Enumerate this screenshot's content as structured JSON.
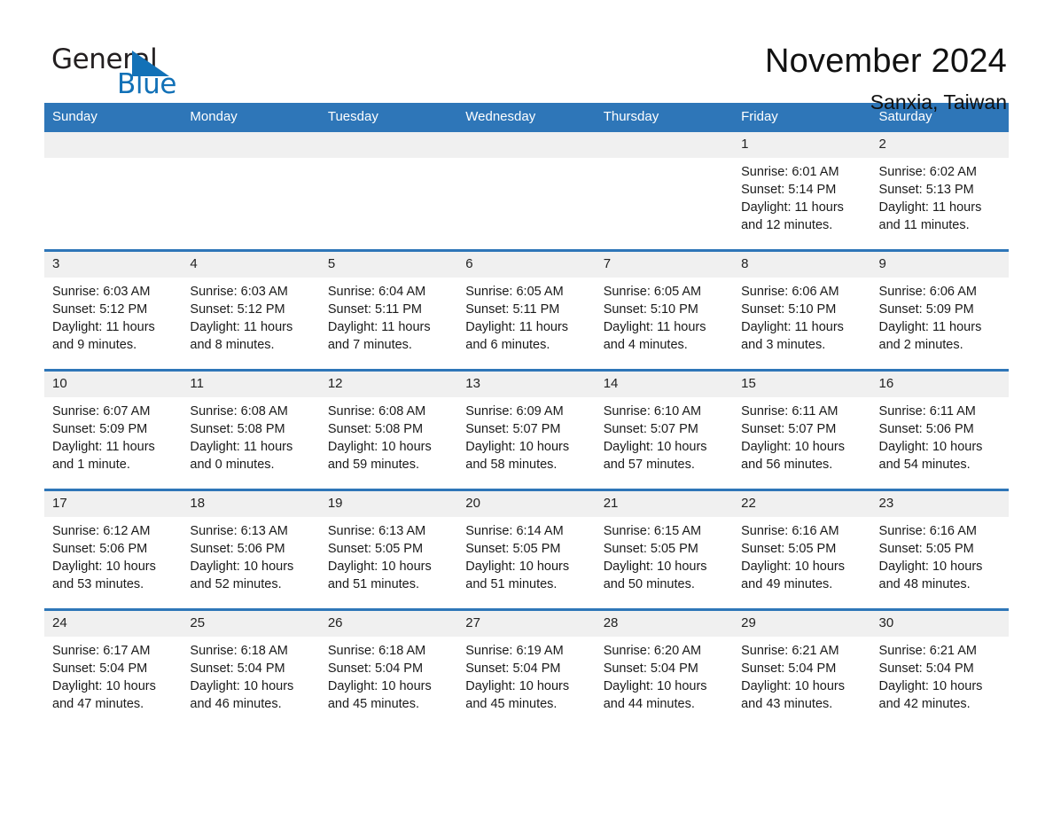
{
  "logo": {
    "word1": "General",
    "word2": "Blue",
    "triangle_color": "#1271b7",
    "icon": "triangle-icon"
  },
  "header": {
    "title": "November 2024",
    "subtitle": "Sanxia, Taiwan"
  },
  "colors": {
    "header_blue": "#2e76b8",
    "daynum_gray": "#f0f0f0",
    "text": "#1a1a1a"
  },
  "calendar": {
    "weekday_headers": [
      "Sunday",
      "Monday",
      "Tuesday",
      "Wednesday",
      "Thursday",
      "Friday",
      "Saturday"
    ],
    "weeks": [
      [
        {
          "day": "",
          "empty": true
        },
        {
          "day": "",
          "empty": true
        },
        {
          "day": "",
          "empty": true
        },
        {
          "day": "",
          "empty": true
        },
        {
          "day": "",
          "empty": true
        },
        {
          "day": "1",
          "sunrise": "Sunrise: 6:01 AM",
          "sunset": "Sunset: 5:14 PM",
          "daylight1": "Daylight: 11 hours",
          "daylight2": "and 12 minutes."
        },
        {
          "day": "2",
          "sunrise": "Sunrise: 6:02 AM",
          "sunset": "Sunset: 5:13 PM",
          "daylight1": "Daylight: 11 hours",
          "daylight2": "and 11 minutes."
        }
      ],
      [
        {
          "day": "3",
          "sunrise": "Sunrise: 6:03 AM",
          "sunset": "Sunset: 5:12 PM",
          "daylight1": "Daylight: 11 hours",
          "daylight2": "and 9 minutes."
        },
        {
          "day": "4",
          "sunrise": "Sunrise: 6:03 AM",
          "sunset": "Sunset: 5:12 PM",
          "daylight1": "Daylight: 11 hours",
          "daylight2": "and 8 minutes."
        },
        {
          "day": "5",
          "sunrise": "Sunrise: 6:04 AM",
          "sunset": "Sunset: 5:11 PM",
          "daylight1": "Daylight: 11 hours",
          "daylight2": "and 7 minutes."
        },
        {
          "day": "6",
          "sunrise": "Sunrise: 6:05 AM",
          "sunset": "Sunset: 5:11 PM",
          "daylight1": "Daylight: 11 hours",
          "daylight2": "and 6 minutes."
        },
        {
          "day": "7",
          "sunrise": "Sunrise: 6:05 AM",
          "sunset": "Sunset: 5:10 PM",
          "daylight1": "Daylight: 11 hours",
          "daylight2": "and 4 minutes."
        },
        {
          "day": "8",
          "sunrise": "Sunrise: 6:06 AM",
          "sunset": "Sunset: 5:10 PM",
          "daylight1": "Daylight: 11 hours",
          "daylight2": "and 3 minutes."
        },
        {
          "day": "9",
          "sunrise": "Sunrise: 6:06 AM",
          "sunset": "Sunset: 5:09 PM",
          "daylight1": "Daylight: 11 hours",
          "daylight2": "and 2 minutes."
        }
      ],
      [
        {
          "day": "10",
          "sunrise": "Sunrise: 6:07 AM",
          "sunset": "Sunset: 5:09 PM",
          "daylight1": "Daylight: 11 hours",
          "daylight2": "and 1 minute."
        },
        {
          "day": "11",
          "sunrise": "Sunrise: 6:08 AM",
          "sunset": "Sunset: 5:08 PM",
          "daylight1": "Daylight: 11 hours",
          "daylight2": "and 0 minutes."
        },
        {
          "day": "12",
          "sunrise": "Sunrise: 6:08 AM",
          "sunset": "Sunset: 5:08 PM",
          "daylight1": "Daylight: 10 hours",
          "daylight2": "and 59 minutes."
        },
        {
          "day": "13",
          "sunrise": "Sunrise: 6:09 AM",
          "sunset": "Sunset: 5:07 PM",
          "daylight1": "Daylight: 10 hours",
          "daylight2": "and 58 minutes."
        },
        {
          "day": "14",
          "sunrise": "Sunrise: 6:10 AM",
          "sunset": "Sunset: 5:07 PM",
          "daylight1": "Daylight: 10 hours",
          "daylight2": "and 57 minutes."
        },
        {
          "day": "15",
          "sunrise": "Sunrise: 6:11 AM",
          "sunset": "Sunset: 5:07 PM",
          "daylight1": "Daylight: 10 hours",
          "daylight2": "and 56 minutes."
        },
        {
          "day": "16",
          "sunrise": "Sunrise: 6:11 AM",
          "sunset": "Sunset: 5:06 PM",
          "daylight1": "Daylight: 10 hours",
          "daylight2": "and 54 minutes."
        }
      ],
      [
        {
          "day": "17",
          "sunrise": "Sunrise: 6:12 AM",
          "sunset": "Sunset: 5:06 PM",
          "daylight1": "Daylight: 10 hours",
          "daylight2": "and 53 minutes."
        },
        {
          "day": "18",
          "sunrise": "Sunrise: 6:13 AM",
          "sunset": "Sunset: 5:06 PM",
          "daylight1": "Daylight: 10 hours",
          "daylight2": "and 52 minutes."
        },
        {
          "day": "19",
          "sunrise": "Sunrise: 6:13 AM",
          "sunset": "Sunset: 5:05 PM",
          "daylight1": "Daylight: 10 hours",
          "daylight2": "and 51 minutes."
        },
        {
          "day": "20",
          "sunrise": "Sunrise: 6:14 AM",
          "sunset": "Sunset: 5:05 PM",
          "daylight1": "Daylight: 10 hours",
          "daylight2": "and 51 minutes."
        },
        {
          "day": "21",
          "sunrise": "Sunrise: 6:15 AM",
          "sunset": "Sunset: 5:05 PM",
          "daylight1": "Daylight: 10 hours",
          "daylight2": "and 50 minutes."
        },
        {
          "day": "22",
          "sunrise": "Sunrise: 6:16 AM",
          "sunset": "Sunset: 5:05 PM",
          "daylight1": "Daylight: 10 hours",
          "daylight2": "and 49 minutes."
        },
        {
          "day": "23",
          "sunrise": "Sunrise: 6:16 AM",
          "sunset": "Sunset: 5:05 PM",
          "daylight1": "Daylight: 10 hours",
          "daylight2": "and 48 minutes."
        }
      ],
      [
        {
          "day": "24",
          "sunrise": "Sunrise: 6:17 AM",
          "sunset": "Sunset: 5:04 PM",
          "daylight1": "Daylight: 10 hours",
          "daylight2": "and 47 minutes."
        },
        {
          "day": "25",
          "sunrise": "Sunrise: 6:18 AM",
          "sunset": "Sunset: 5:04 PM",
          "daylight1": "Daylight: 10 hours",
          "daylight2": "and 46 minutes."
        },
        {
          "day": "26",
          "sunrise": "Sunrise: 6:18 AM",
          "sunset": "Sunset: 5:04 PM",
          "daylight1": "Daylight: 10 hours",
          "daylight2": "and 45 minutes."
        },
        {
          "day": "27",
          "sunrise": "Sunrise: 6:19 AM",
          "sunset": "Sunset: 5:04 PM",
          "daylight1": "Daylight: 10 hours",
          "daylight2": "and 45 minutes."
        },
        {
          "day": "28",
          "sunrise": "Sunrise: 6:20 AM",
          "sunset": "Sunset: 5:04 PM",
          "daylight1": "Daylight: 10 hours",
          "daylight2": "and 44 minutes."
        },
        {
          "day": "29",
          "sunrise": "Sunrise: 6:21 AM",
          "sunset": "Sunset: 5:04 PM",
          "daylight1": "Daylight: 10 hours",
          "daylight2": "and 43 minutes."
        },
        {
          "day": "30",
          "sunrise": "Sunrise: 6:21 AM",
          "sunset": "Sunset: 5:04 PM",
          "daylight1": "Daylight: 10 hours",
          "daylight2": "and 42 minutes."
        }
      ]
    ]
  }
}
